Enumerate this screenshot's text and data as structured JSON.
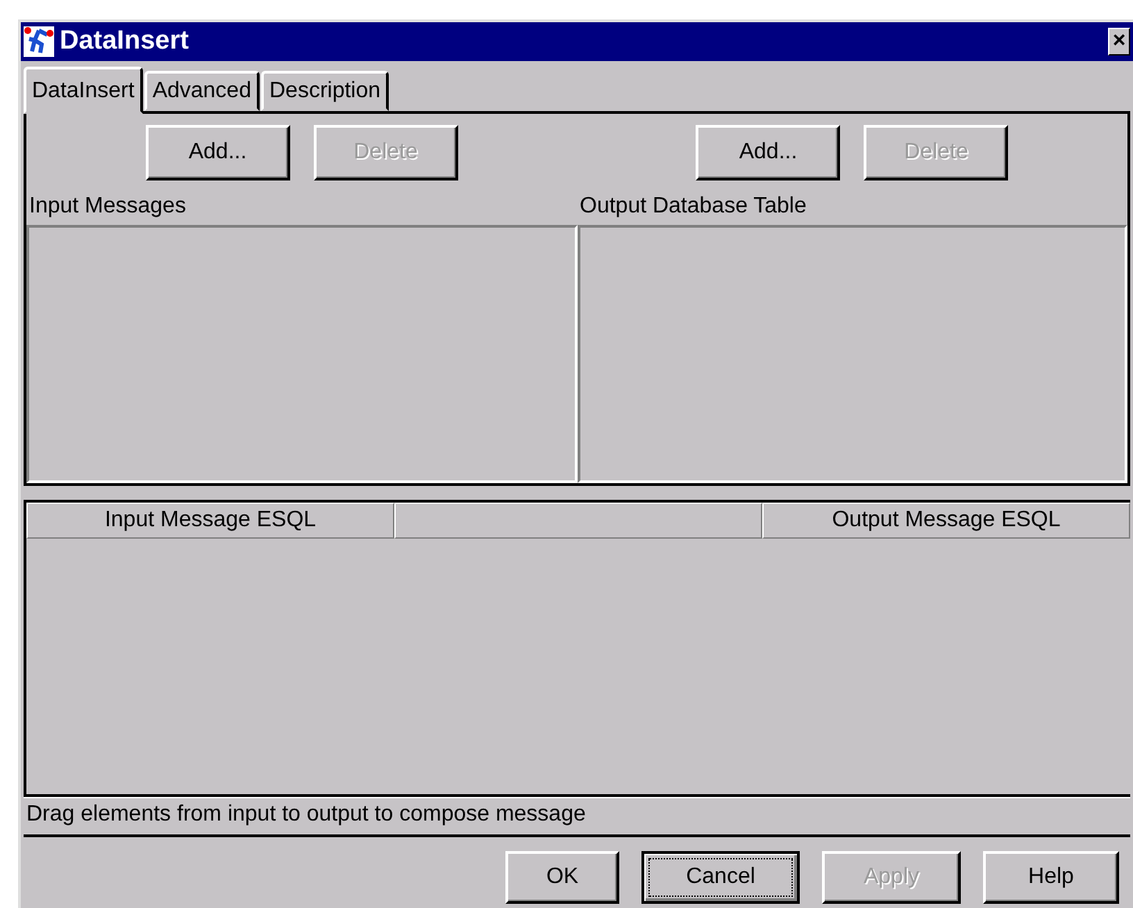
{
  "window": {
    "title": "DataInsert",
    "close": "×"
  },
  "tabs": [
    {
      "label": "DataInsert",
      "selected": true
    },
    {
      "label": "Advanced",
      "selected": false
    },
    {
      "label": "Description",
      "selected": false
    }
  ],
  "panes": [
    {
      "label": "Input Messages",
      "buttons": [
        {
          "label": "Add...",
          "disabled": false
        },
        {
          "label": "Delete",
          "disabled": true
        }
      ]
    },
    {
      "label": "Output Database Table",
      "buttons": [
        {
          "label": "Add...",
          "disabled": false
        },
        {
          "label": "Delete",
          "disabled": true
        }
      ]
    }
  ],
  "table": {
    "columns": [
      "Input Message ESQL",
      "",
      "Output Message ESQL"
    ]
  },
  "status_bar": "Drag elements from input to output to compose message",
  "buttons": [
    {
      "label": "OK",
      "disabled": false,
      "focused": false
    },
    {
      "label": "Cancel",
      "disabled": false,
      "focused": true
    },
    {
      "label": "Apply",
      "disabled": true,
      "focused": false
    },
    {
      "label": "Help",
      "disabled": false,
      "focused": false
    }
  ]
}
